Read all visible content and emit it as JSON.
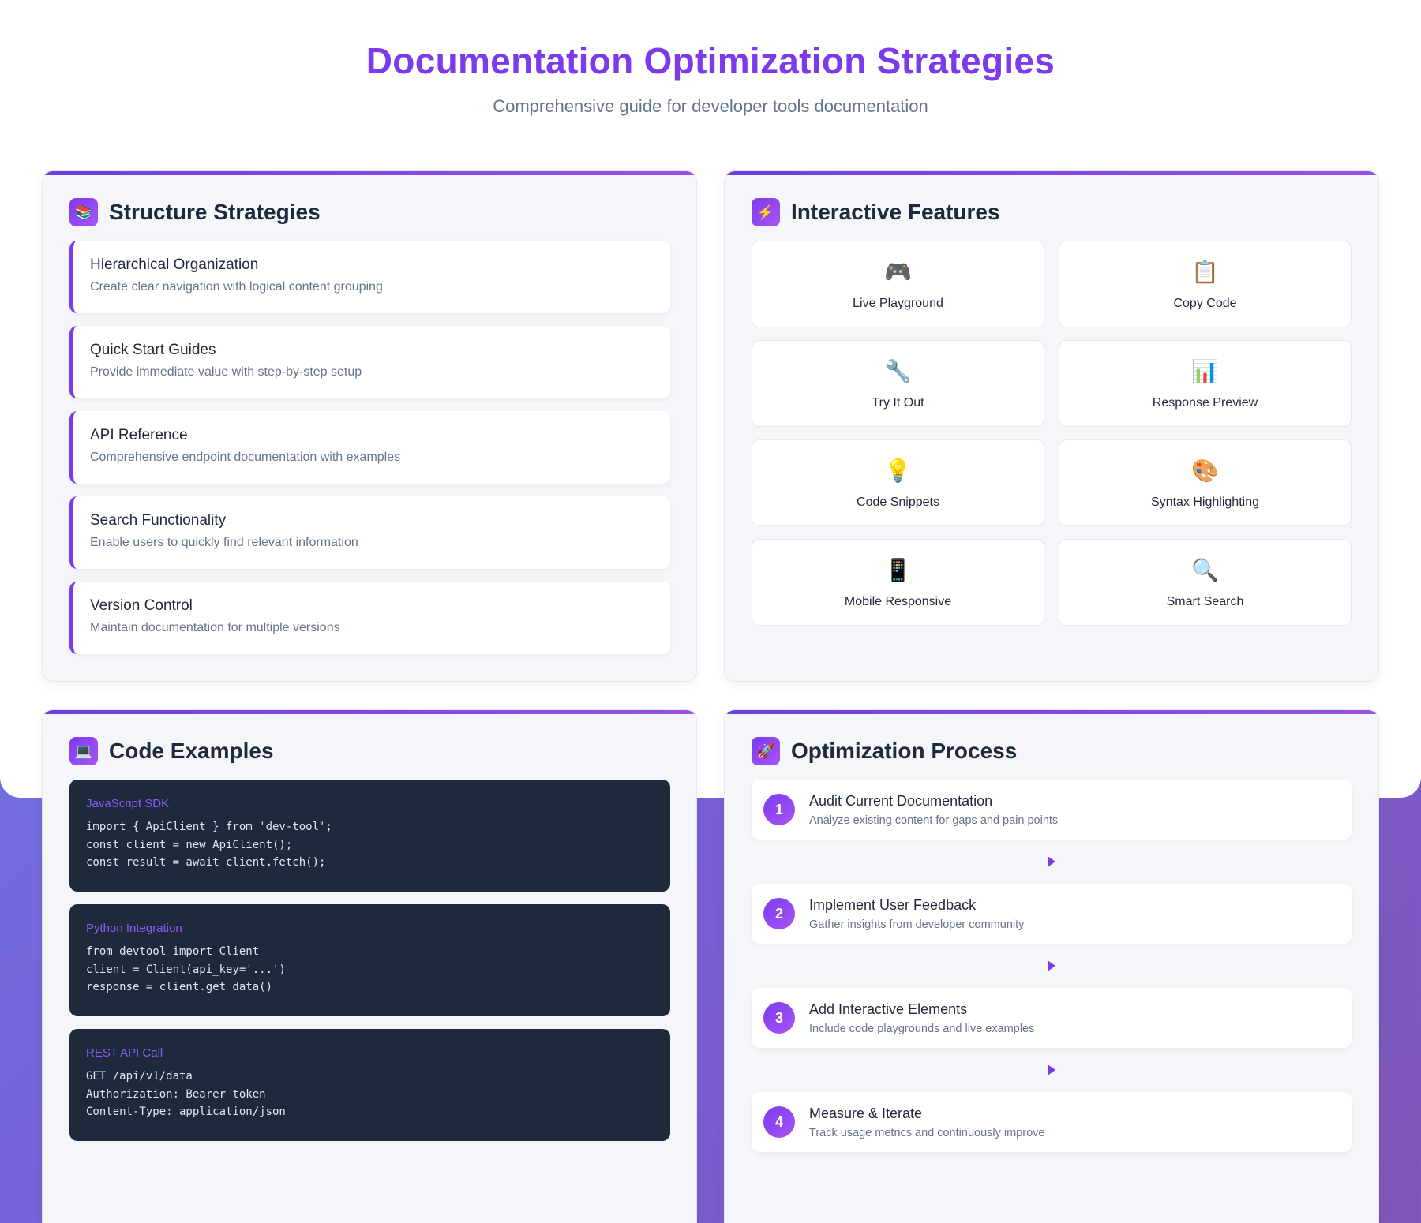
{
  "header": {
    "title": "Documentation Optimization Strategies",
    "subtitle": "Comprehensive guide for developer tools documentation"
  },
  "structure": {
    "title": "Structure Strategies",
    "icon": "📚",
    "items": [
      {
        "title": "Hierarchical Organization",
        "desc": "Create clear navigation with logical content grouping"
      },
      {
        "title": "Quick Start Guides",
        "desc": "Provide immediate value with step-by-step setup"
      },
      {
        "title": "API Reference",
        "desc": "Comprehensive endpoint documentation with examples"
      },
      {
        "title": "Search Functionality",
        "desc": "Enable users to quickly find relevant information"
      },
      {
        "title": "Version Control",
        "desc": "Maintain documentation for multiple versions"
      }
    ]
  },
  "interactive": {
    "title": "Interactive Features",
    "icon": "⚡",
    "features": [
      {
        "icon": "🎮",
        "label": "Live Playground"
      },
      {
        "icon": "📋",
        "label": "Copy Code"
      },
      {
        "icon": "🔧",
        "label": "Try It Out"
      },
      {
        "icon": "📊",
        "label": "Response Preview"
      },
      {
        "icon": "💡",
        "label": "Code Snippets"
      },
      {
        "icon": "🎨",
        "label": "Syntax Highlighting"
      },
      {
        "icon": "📱",
        "label": "Mobile Responsive"
      },
      {
        "icon": "🔍",
        "label": "Smart Search"
      }
    ]
  },
  "code": {
    "title": "Code Examples",
    "icon": "💻",
    "blocks": [
      {
        "lang": "JavaScript SDK",
        "lines": [
          "import { ApiClient } from 'dev-tool';",
          "const client = new ApiClient();",
          "const result = await client.fetch();"
        ]
      },
      {
        "lang": "Python Integration",
        "lines": [
          "from devtool import Client",
          "client = Client(api_key='...')",
          "response = client.get_data()"
        ]
      },
      {
        "lang": "REST API Call",
        "lines": [
          "GET /api/v1/data",
          "Authorization: Bearer token",
          "Content-Type: application/json"
        ]
      }
    ]
  },
  "process": {
    "title": "Optimization Process",
    "icon": "🚀",
    "steps": [
      {
        "num": "1",
        "title": "Audit Current Documentation",
        "desc": "Analyze existing content for gaps and pain points"
      },
      {
        "num": "2",
        "title": "Implement User Feedback",
        "desc": "Gather insights from developer community"
      },
      {
        "num": "3",
        "title": "Add Interactive Elements",
        "desc": "Include code playgrounds and live examples"
      },
      {
        "num": "4",
        "title": "Measure & Iterate",
        "desc": "Track usage metrics and continuously improve"
      }
    ]
  }
}
